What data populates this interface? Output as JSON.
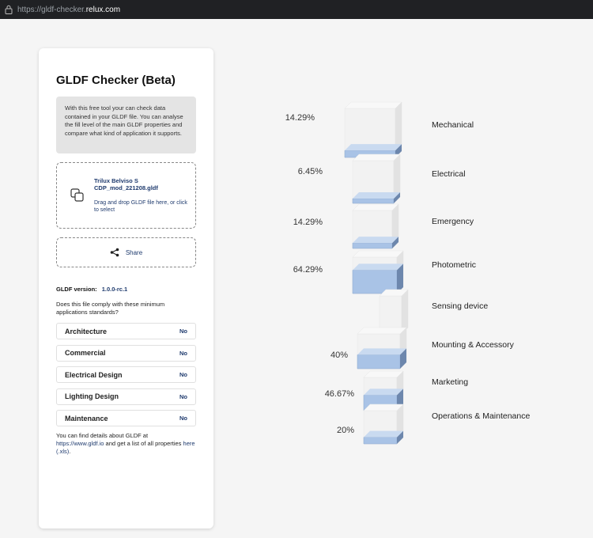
{
  "browser": {
    "url_scheme": "https://",
    "url_host_prefix": "gldf-checker.",
    "url_host": "relux.com"
  },
  "card": {
    "title": "GLDF Checker (Beta)",
    "intro": "With this free tool your can check data contained in your GLDF file. You can analyse the fill level of the main GLDF properties and compare what kind of application it supports.",
    "file_name": "Trilux Belviso S CDP_mod_221208.gldf",
    "drop_hint": "Drag and drop GLDF file here, or click to select",
    "share_label": "Share",
    "version_label": "GLDF version:",
    "version_value": "1.0.0-rc.1",
    "question": "Does this file comply with these minimum applications standards?",
    "standards": [
      {
        "name": "Architecture",
        "value": "No"
      },
      {
        "name": "Commercial",
        "value": "No"
      },
      {
        "name": "Electrical Design",
        "value": "No"
      },
      {
        "name": "Lighting Design",
        "value": "No"
      },
      {
        "name": "Maintenance",
        "value": "No"
      }
    ],
    "footer_text1": "You can find details about GLDF at",
    "footer_link1": "https://www.gldf.io",
    "footer_text2": "and get a list of all properties",
    "footer_link2": "here (.xls)",
    "footer_text3": "."
  },
  "categories": [
    {
      "label": "Mechanical",
      "percent_text": "14.29%",
      "fill": 0.1429
    },
    {
      "label": "Electrical",
      "percent_text": "6.45%",
      "fill": 0.0645
    },
    {
      "label": "Emergency",
      "percent_text": "14.29%",
      "fill": 0.1429
    },
    {
      "label": "Photometric",
      "percent_text": "64.29%",
      "fill": 0.6429
    },
    {
      "label": "Sensing device",
      "percent_text": "",
      "fill": 0
    },
    {
      "label": "Mounting & Accessory",
      "percent_text": "40%",
      "fill": 0.4
    },
    {
      "label": "Marketing",
      "percent_text": "46.67%",
      "fill": 0.4667
    },
    {
      "label": "Operations & Maintenance",
      "percent_text": "20%",
      "fill": 0.2
    }
  ],
  "colors": {
    "accent": "#1f3b6e",
    "fill_front": "#a9c3e6",
    "fill_side": "#6d87ad",
    "fill_top": "#c9daf0",
    "box_front": "#f2f2f2",
    "box_side": "#e2e2e2"
  }
}
